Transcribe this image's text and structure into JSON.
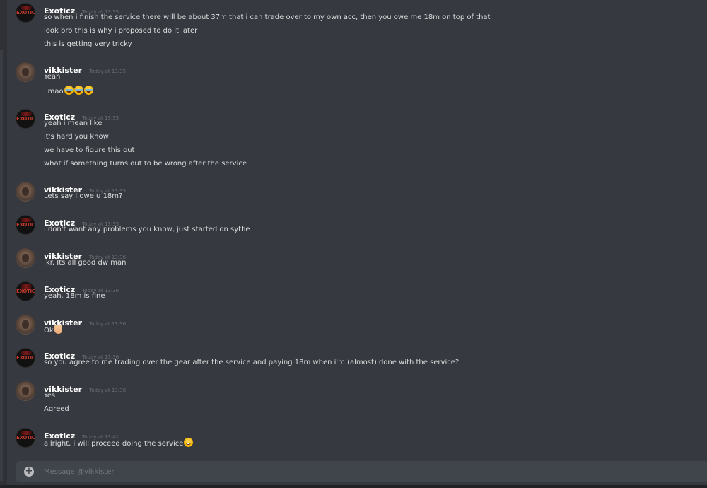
{
  "messages": [
    {
      "author": "Exoticz",
      "timestamp": "Today at 13:35",
      "avatar": "exoticz-avatar",
      "lines": [
        "so when i finish the service there will be about 37m that i can trade over to my own acc, then you owe me 18m on top of that",
        "look bro this is why i proposed to do it later",
        "this is getting very tricky"
      ]
    },
    {
      "author": "vikkister",
      "timestamp": "Today at 13:35",
      "avatar": "vikkister-avatar",
      "lines": [
        "Yeah",
        "Lmao"
      ]
    },
    {
      "author": "Exoticz",
      "timestamp": "Today at 13:35",
      "avatar": "exoticz-avatar",
      "lines": [
        "yeah i mean like",
        "it's hard you know",
        "we have to figure this out",
        "what if something turns out to be wrong after the service"
      ]
    },
    {
      "author": "vikkister",
      "timestamp": "Today at 13:35",
      "avatar": "vikkister-avatar",
      "lines": [
        "Lets say I owe u 18m?"
      ]
    },
    {
      "author": "Exoticz",
      "timestamp": "Today at 13:35",
      "avatar": "exoticz-avatar",
      "lines": [
        "i don't want any problems you know, just started on sythe"
      ]
    },
    {
      "author": "vikkister",
      "timestamp": "Today at 13:36",
      "avatar": "vikkister-avatar",
      "lines": [
        "Ikr. Its all good dw man"
      ]
    },
    {
      "author": "Exoticz",
      "timestamp": "Today at 13:36",
      "avatar": "exoticz-avatar",
      "lines": [
        "yeah, 18m is fine"
      ]
    },
    {
      "author": "vikkister",
      "timestamp": "Today at 13:36",
      "avatar": "vikkister-avatar",
      "lines": [
        "Ok"
      ]
    },
    {
      "author": "Exoticz",
      "timestamp": "Today at 13:36",
      "avatar": "exoticz-avatar",
      "lines": [
        "so you agree to me trading over the gear after the service and paying 18m when i'm (almost) done with the service?"
      ]
    },
    {
      "author": "vikkister",
      "timestamp": "Today at 13:36",
      "avatar": "vikkister-avatar",
      "lines": [
        "Yes",
        "Agreed"
      ]
    },
    {
      "author": "Exoticz",
      "timestamp": "Today at 13:41",
      "avatar": "exoticz-avatar",
      "lines": [
        "allright, i will proceed doing the service"
      ]
    }
  ],
  "emojis": {
    "laugh": "joy-emoji",
    "thumbs": "thumbs-up-emoji",
    "grin": "grin-emoji"
  },
  "avatar_text": "EXOTICZ",
  "composer": {
    "placeholder": "Message @vikkister",
    "plus_icon": "plus-circle-icon"
  },
  "colors": {
    "background": "#36393f",
    "username": "#ffffff",
    "text": "#dcddde",
    "timestamp": "#6b6f77",
    "composer": "#40444b"
  }
}
